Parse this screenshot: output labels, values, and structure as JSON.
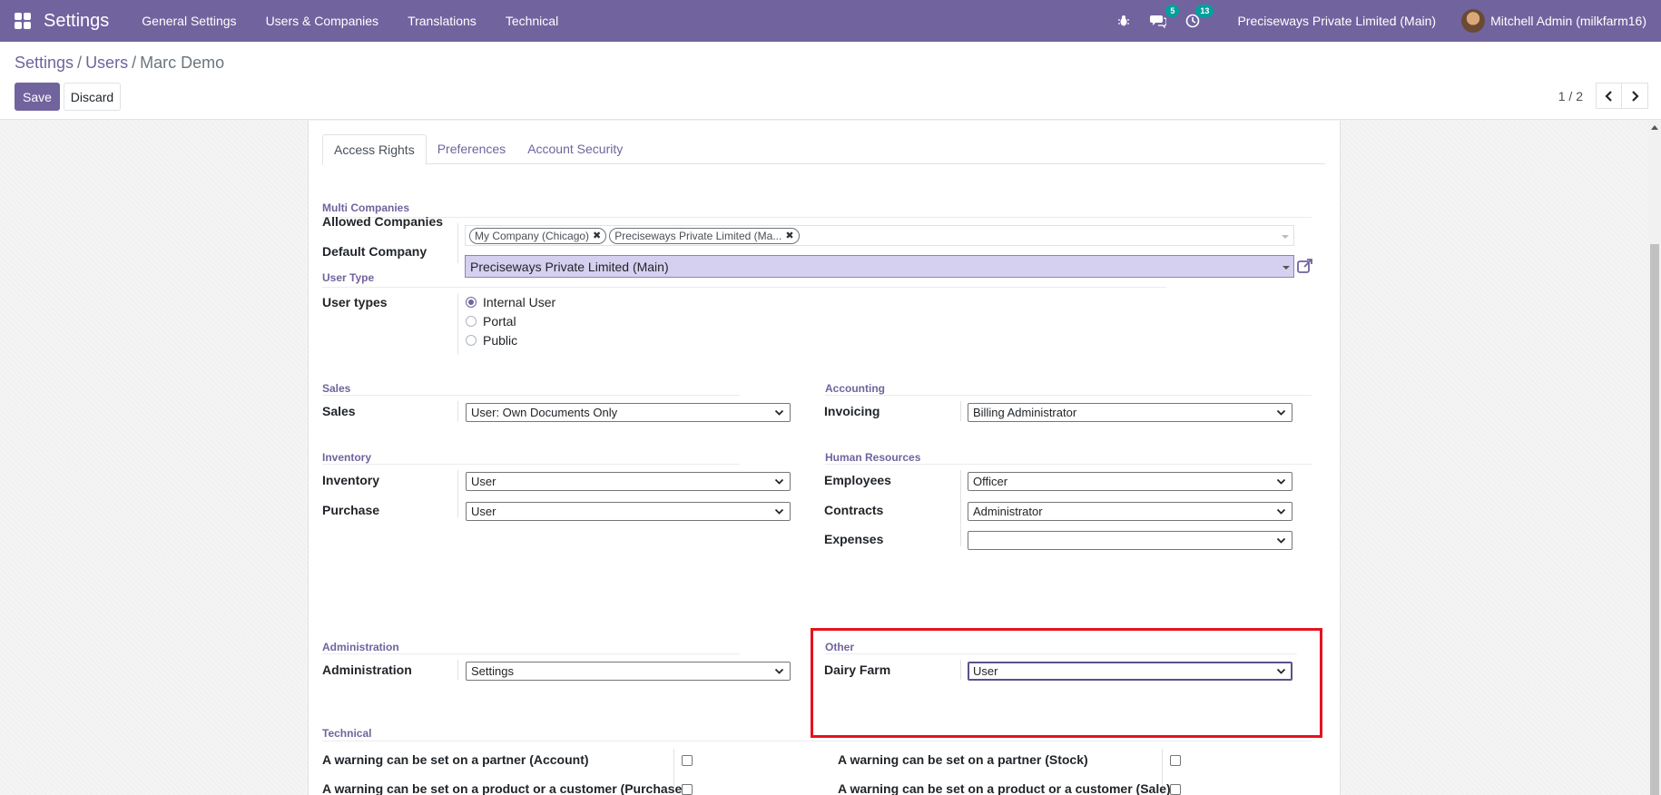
{
  "navbar": {
    "app_name": "Settings",
    "menu": [
      "General Settings",
      "Users & Companies",
      "Translations",
      "Technical"
    ],
    "messages_count": "5",
    "activities_count": "13",
    "company": "Preciseways Private Limited (Main)",
    "user": "Mitchell Admin (milkfarm16)"
  },
  "breadcrumb": {
    "items": [
      "Settings",
      "Users"
    ],
    "current": "Marc Demo"
  },
  "buttons": {
    "save": "Save",
    "discard": "Discard"
  },
  "pager": {
    "value": "1 / 2"
  },
  "tabs": [
    "Access Rights",
    "Preferences",
    "Account Security"
  ],
  "multi_companies": {
    "title": "Multi Companies",
    "allowed_label": "Allowed Companies",
    "allowed_tags": [
      "My Company (Chicago)",
      "Preciseways Private Limited (Ma..."
    ],
    "default_label": "Default Company",
    "default_value": "Preciseways Private Limited (Main)"
  },
  "user_type": {
    "title": "User Type",
    "label": "User types",
    "options": [
      "Internal User",
      "Portal",
      "Public"
    ],
    "selected": "Internal User"
  },
  "sales": {
    "title": "Sales",
    "label": "Sales",
    "value": "User: Own Documents Only"
  },
  "accounting": {
    "title": "Accounting",
    "label": "Invoicing",
    "value": "Billing Administrator"
  },
  "inventory": {
    "title": "Inventory",
    "inventory_label": "Inventory",
    "inventory_value": "User",
    "purchase_label": "Purchase",
    "purchase_value": "User"
  },
  "human_resources": {
    "title": "Human Resources",
    "employees_label": "Employees",
    "employees_value": "Officer",
    "contracts_label": "Contracts",
    "contracts_value": "Administrator",
    "expenses_label": "Expenses",
    "expenses_value": ""
  },
  "administration": {
    "title": "Administration",
    "label": "Administration",
    "value": "Settings"
  },
  "other": {
    "title": "Other",
    "label": "Dairy Farm",
    "value": "User"
  },
  "technical": {
    "title": "Technical",
    "items": [
      "A warning can be set on a partner (Account)",
      "A warning can be set on a partner (Stock)",
      "A warning can be set on a product or a customer (Purchase)",
      "A warning can be set on a product or a customer (Sale)"
    ]
  },
  "colors": {
    "brand": "#71639e",
    "highlight": "#e5121e",
    "badge": "#00a09d"
  }
}
